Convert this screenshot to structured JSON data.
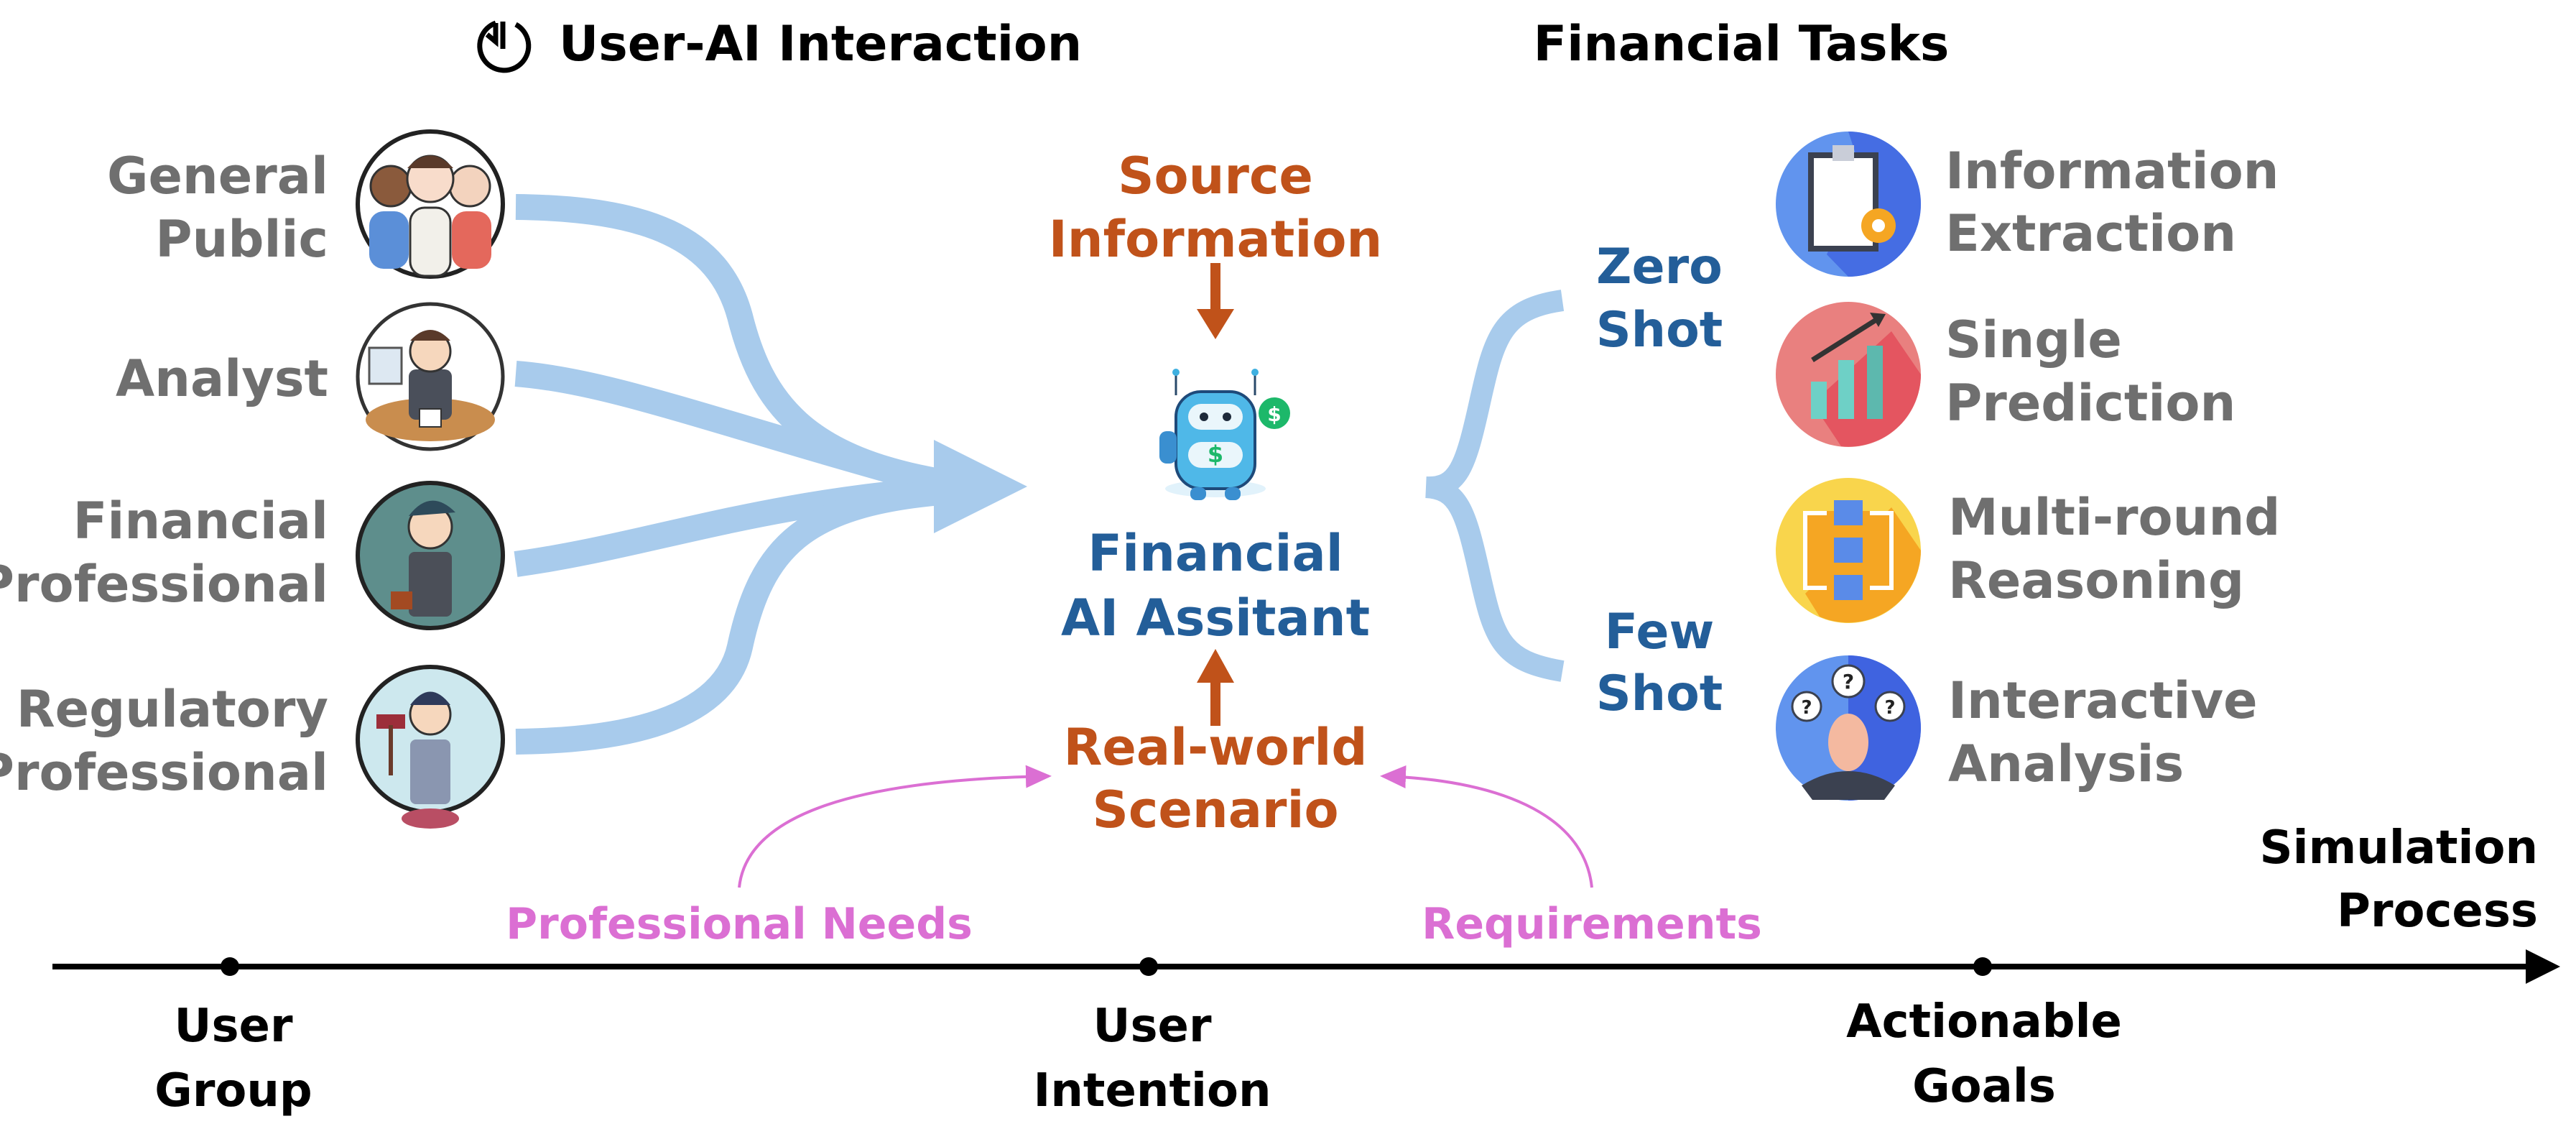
{
  "header": {
    "left_title": "User-AI Interaction",
    "left_title_icon": "cycle-arrow-icon",
    "right_title": "Financial Tasks"
  },
  "user_groups": [
    {
      "line1": "General",
      "line2": "Public",
      "icon": "general-public-avatar"
    },
    {
      "line1": "Analyst",
      "line2": "",
      "icon": "analyst-avatar"
    },
    {
      "line1": "Financial",
      "line2": "Professional",
      "icon": "financial-professional-avatar"
    },
    {
      "line1": "Regulatory",
      "line2": "Professional",
      "icon": "regulatory-professional-avatar"
    }
  ],
  "center": {
    "source_line1": "Source",
    "source_line2": "Information",
    "assistant_line1": "Financial",
    "assistant_line2": "AI Assitant",
    "scenario_line1": "Real-world",
    "scenario_line2": "Scenario",
    "robot_icon": "robot-assistant-icon"
  },
  "shots": [
    {
      "line1": "Zero",
      "line2": "Shot"
    },
    {
      "line1": "Few",
      "line2": "Shot"
    }
  ],
  "tasks": [
    {
      "line1": "Information",
      "line2": "Extraction",
      "icon": "clipboard-gear-icon"
    },
    {
      "line1": "Single",
      "line2": "Prediction",
      "icon": "bar-chart-trend-icon"
    },
    {
      "line1": "Multi-round",
      "line2": "Reasoning",
      "icon": "flow-loop-icon"
    },
    {
      "line1": "Interactive",
      "line2": "Analysis",
      "icon": "person-questions-icon"
    }
  ],
  "annotations": {
    "professional_needs": "Professional Needs",
    "requirements": "Requirements"
  },
  "timeline": {
    "end_label_line1": "Simulation",
    "end_label_line2": "Process",
    "stages": [
      {
        "line1": "User",
        "line2": "Group"
      },
      {
        "line1": "User",
        "line2": "Intention"
      },
      {
        "line1": "Actionable",
        "line2": "Goals"
      }
    ]
  },
  "colors": {
    "flow_blue": "#A8CBEC",
    "orange": "#C0521A",
    "navy": "#235E99",
    "pink": "#DB6FD3",
    "grey_text": "#6F6F6F"
  }
}
